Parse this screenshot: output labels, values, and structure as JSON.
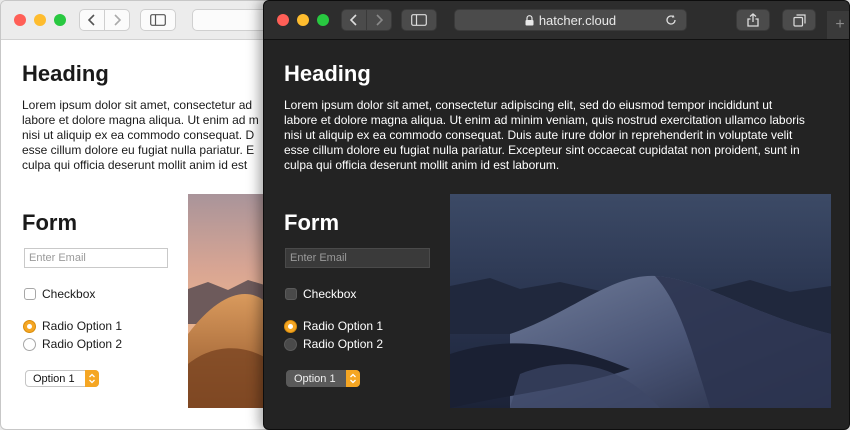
{
  "light": {
    "heading": "Heading",
    "para_lines": [
      "Lorem ipsum dolor sit amet, consectetur ad",
      "labore et dolore magna aliqua. Ut enim ad m",
      "nisi ut aliquip ex ea commodo consequat. D",
      "esse cillum dolore eu fugiat nulla pariatur. E",
      "culpa qui officia deserunt mollit anim id est"
    ],
    "form_title": "Form",
    "email_placeholder": "Enter Email",
    "checkbox_label": "Checkbox",
    "radio1_label": "Radio Option 1",
    "radio2_label": "Radio Option 2",
    "select_value": "Option 1"
  },
  "dark": {
    "url": "hatcher.cloud",
    "heading": "Heading",
    "para_lines": [
      "Lorem ipsum dolor sit amet, consectetur adipiscing elit, sed do eiusmod tempor incididunt ut",
      "labore et dolore magna aliqua. Ut enim ad minim veniam, quis nostrud exercitation ullamco laboris",
      "nisi ut aliquip ex ea commodo consequat. Duis aute irure dolor in reprehenderit in voluptate velit",
      "esse cillum dolore eu fugiat nulla pariatur. Excepteur sint occaecat cupidatat non proident, sunt in",
      "culpa qui officia deserunt mollit anim id est laborum."
    ],
    "form_title": "Form",
    "email_placeholder": "Enter Email",
    "checkbox_label": "Checkbox",
    "radio1_label": "Radio Option 1",
    "radio2_label": "Radio Option 2",
    "select_value": "Option 1",
    "new_tab_glyph": "+"
  },
  "icons": [
    "back-chevron-icon",
    "forward-chevron-icon",
    "sidebar-icon",
    "lock-icon",
    "reload-icon",
    "share-icon",
    "tabs-icon",
    "plus-icon"
  ],
  "colors": {
    "accent": "#f5a623",
    "close": "#ff5f57",
    "minimize": "#febc2e",
    "zoom": "#28c840"
  }
}
